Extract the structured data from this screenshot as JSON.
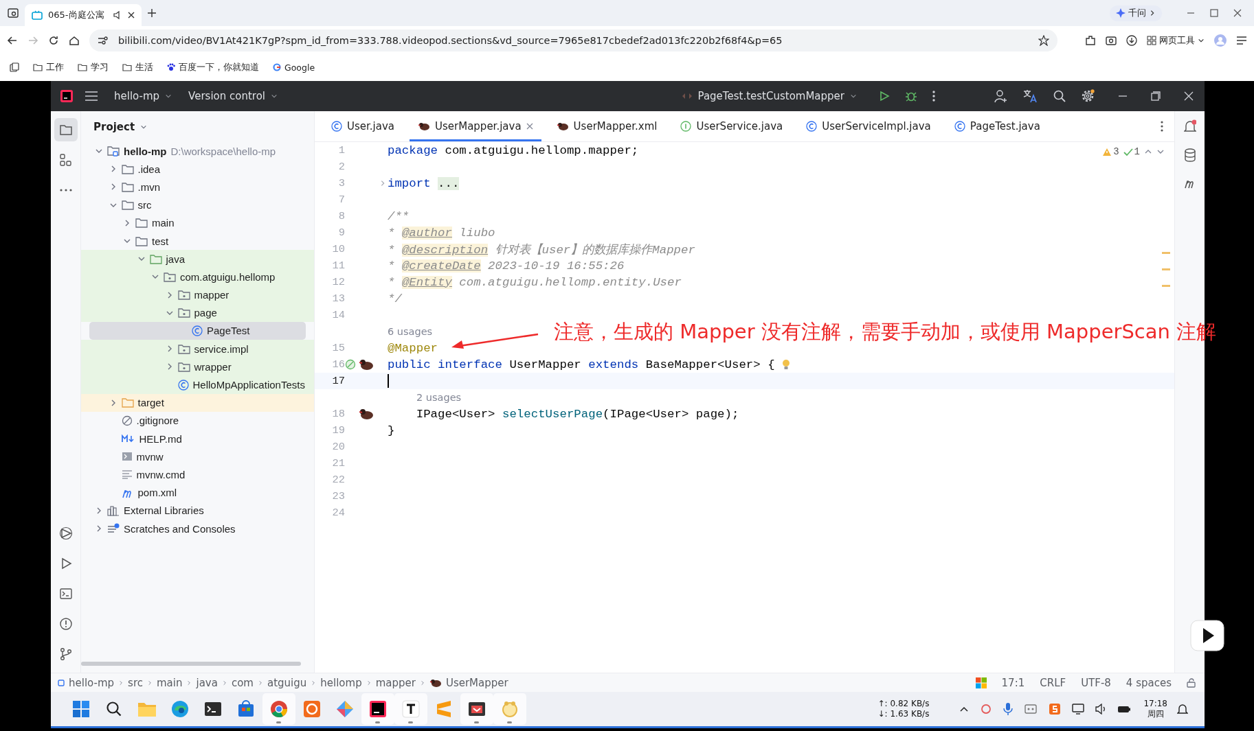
{
  "browser": {
    "tabs": [
      {
        "title": "065-尚庭公寓",
        "selected": true
      }
    ],
    "assistant": {
      "label": "千问"
    },
    "url": "bilibili.com/video/BV1At421K7gP?spm_id_from=333.788.videopod.sections&vd_source=7965e817cbedef2ad013fc220b2f68f4&p=65",
    "tools_label": "网页工具",
    "bookmarks": [
      {
        "label": "工作",
        "kind": "folder"
      },
      {
        "label": "学习",
        "kind": "folder"
      },
      {
        "label": "生活",
        "kind": "folder"
      },
      {
        "label": "百度一下，你就知道",
        "kind": "baidu"
      },
      {
        "label": "Google",
        "kind": "google"
      }
    ]
  },
  "ide": {
    "project": "hello-mp",
    "vcs": "Version control",
    "run_config": "PageTest.testCustomMapper",
    "panel_title": "Project",
    "tree": [
      {
        "name": "hello-mp",
        "hint": "D:\\workspace\\hello-mp",
        "kind": "module",
        "expanded": true,
        "selected": false,
        "children": [
          {
            "name": ".idea",
            "kind": "folder",
            "expanded": false,
            "selected": false
          },
          {
            "name": ".mvn",
            "kind": "folder",
            "expanded": false,
            "selected": false
          },
          {
            "name": "src",
            "kind": "folder",
            "expanded": true,
            "selected": false,
            "children": [
              {
                "name": "main",
                "kind": "folder",
                "expanded": false,
                "selected": false
              },
              {
                "name": "test",
                "kind": "folder",
                "expanded": true,
                "selected": false,
                "children": [
                  {
                    "name": "java",
                    "kind": "test-root",
                    "expanded": true,
                    "selected": false,
                    "test_source": true,
                    "children": [
                      {
                        "name": "com.atguigu.hellomp",
                        "kind": "package",
                        "expanded": true,
                        "selected": false,
                        "test_source": true,
                        "children": [
                          {
                            "name": "mapper",
                            "kind": "package",
                            "expanded": false,
                            "selected": false,
                            "test_source": true
                          },
                          {
                            "name": "page",
                            "kind": "package",
                            "expanded": true,
                            "selected": false,
                            "test_source": true,
                            "children": [
                              {
                                "name": "PageTest",
                                "kind": "class",
                                "selected": true,
                                "test_source": true
                              }
                            ]
                          },
                          {
                            "name": "service.impl",
                            "kind": "package",
                            "expanded": false,
                            "selected": false,
                            "test_source": true
                          },
                          {
                            "name": "wrapper",
                            "kind": "package",
                            "expanded": false,
                            "selected": false,
                            "test_source": true
                          },
                          {
                            "name": "HelloMpApplicationTests",
                            "kind": "class",
                            "selected": false,
                            "test_source": true
                          }
                        ]
                      }
                    ]
                  }
                ]
              }
            ]
          },
          {
            "name": "target",
            "kind": "excluded",
            "expanded": false,
            "selected": false,
            "excluded": true
          },
          {
            "name": ".gitignore",
            "kind": "ignore",
            "selected": false
          },
          {
            "name": "HELP.md",
            "kind": "markdown",
            "selected": false
          },
          {
            "name": "mvnw",
            "kind": "script",
            "selected": false
          },
          {
            "name": "mvnw.cmd",
            "kind": "text",
            "selected": false
          },
          {
            "name": "pom.xml",
            "kind": "maven",
            "selected": false
          }
        ]
      },
      {
        "name": "External Libraries",
        "kind": "library",
        "expanded": false,
        "selected": false
      },
      {
        "name": "Scratches and Consoles",
        "kind": "scratches",
        "expanded": false,
        "selected": false
      }
    ],
    "editor_tabs": [
      {
        "label": "User.java",
        "kind": "class",
        "selected": false
      },
      {
        "label": "UserMapper.java",
        "kind": "mapper",
        "selected": true
      },
      {
        "label": "UserMapper.xml",
        "kind": "mapper",
        "selected": false
      },
      {
        "label": "UserService.java",
        "kind": "interface",
        "selected": false
      },
      {
        "label": "UserServiceImpl.java",
        "kind": "class",
        "selected": false
      },
      {
        "label": "PageTest.java",
        "kind": "class",
        "selected": false
      }
    ],
    "inspections": {
      "warnings": "3",
      "passed": "1"
    },
    "lines": [
      {
        "kind": "code",
        "number": "1",
        "tokens": [
          {
            "kind": "kw",
            "text": "package"
          },
          {
            "kind": "plain",
            "text": " com.atguigu.hellomp.mapper;"
          }
        ]
      },
      {
        "kind": "code",
        "number": "2"
      },
      {
        "kind": "code",
        "number": "3",
        "fold": true,
        "tokens": [
          {
            "kind": "kw",
            "text": "import"
          },
          {
            "kind": "folded",
            "text": "..."
          }
        ]
      },
      {
        "kind": "code",
        "number": "7"
      },
      {
        "kind": "code",
        "number": "8",
        "tokens": [
          {
            "kind": "comment",
            "text": "/**"
          }
        ]
      },
      {
        "kind": "code",
        "number": "9",
        "tokens": [
          {
            "kind": "comment",
            "text": "* "
          },
          {
            "kind": "tag",
            "text": "@author"
          },
          {
            "kind": "comment",
            "text": " liubo"
          }
        ]
      },
      {
        "kind": "code",
        "number": "10",
        "tokens": [
          {
            "kind": "comment",
            "text": "* "
          },
          {
            "kind": "tag",
            "text": "@description"
          },
          {
            "kind": "comment",
            "text": " 针对表【user】的数据库操作Mapper"
          }
        ]
      },
      {
        "kind": "code",
        "number": "11",
        "tokens": [
          {
            "kind": "comment",
            "text": "* "
          },
          {
            "kind": "tag",
            "text": "@createDate"
          },
          {
            "kind": "comment",
            "text": " 2023-10-19 16:55:26"
          }
        ]
      },
      {
        "kind": "code",
        "number": "12",
        "tokens": [
          {
            "kind": "comment",
            "text": "* "
          },
          {
            "kind": "tag",
            "text": "@Entity"
          },
          {
            "kind": "comment",
            "text": " com.atguigu.hellomp.entity.User"
          }
        ]
      },
      {
        "kind": "code",
        "number": "13",
        "tokens": [
          {
            "kind": "comment",
            "text": "*/"
          }
        ]
      },
      {
        "kind": "code",
        "number": "14"
      },
      {
        "kind": "hint",
        "text": "6 usages",
        "nested": false
      },
      {
        "kind": "code",
        "number": "15",
        "tokens": [
          {
            "kind": "annotation",
            "text": "@Mapper"
          }
        ]
      },
      {
        "kind": "code",
        "number": "16",
        "implemented": true,
        "mapped": true,
        "intention": true,
        "tokens": [
          {
            "kind": "kw",
            "text": "public interface"
          },
          {
            "kind": "plain",
            "text": " UserMapper "
          },
          {
            "kind": "kw",
            "text": "extends"
          },
          {
            "kind": "plain",
            "text": " BaseMapper<User> {"
          }
        ]
      },
      {
        "kind": "code",
        "number": "17",
        "current": true
      },
      {
        "kind": "hint",
        "text": "2 usages",
        "nested": true
      },
      {
        "kind": "code",
        "number": "18",
        "mapped": true,
        "tokens": [
          {
            "kind": "plain",
            "text": "    IPage<User> "
          },
          {
            "kind": "method",
            "text": "selectUserPage"
          },
          {
            "kind": "plain",
            "text": "(IPage<User> page);"
          }
        ]
      },
      {
        "kind": "code",
        "number": "19",
        "tokens": [
          {
            "kind": "plain",
            "text": "}"
          }
        ]
      },
      {
        "kind": "code",
        "number": "20"
      },
      {
        "kind": "code",
        "number": "21"
      },
      {
        "kind": "code",
        "number": "22"
      },
      {
        "kind": "code",
        "number": "23"
      },
      {
        "kind": "code",
        "number": "24"
      }
    ],
    "breadcrumbs": [
      "hello-mp",
      "src",
      "main",
      "java",
      "com",
      "atguigu",
      "hellomp",
      "mapper",
      "UserMapper"
    ],
    "status": {
      "position": "17:1",
      "line_endings": "CRLF",
      "encoding": "UTF-8",
      "indent": "4 spaces"
    }
  },
  "overlay": {
    "note": "注意，生成的 Mapper 没有注解，需要手动加，或使用 MapperScan 注解"
  },
  "taskbar": {
    "apps": [
      {
        "kind": "start",
        "selected": false
      },
      {
        "kind": "search",
        "selected": false
      },
      {
        "kind": "files",
        "selected": false
      },
      {
        "kind": "edge",
        "selected": false
      },
      {
        "kind": "terminal",
        "selected": false
      },
      {
        "kind": "store",
        "selected": false
      },
      {
        "kind": "chrome",
        "selected": true
      },
      {
        "kind": "orange",
        "selected": false
      },
      {
        "kind": "colorful",
        "selected": false
      },
      {
        "kind": "idea",
        "selected": true
      },
      {
        "kind": "typora",
        "selected": true
      },
      {
        "kind": "sublime",
        "selected": false
      },
      {
        "kind": "tool",
        "selected": true
      },
      {
        "kind": "yellow",
        "selected": true
      }
    ],
    "upload": "↑: 0.82 KB/s",
    "download": "↓: 1.63 KB/s",
    "time": "17:18",
    "day": "周四"
  }
}
